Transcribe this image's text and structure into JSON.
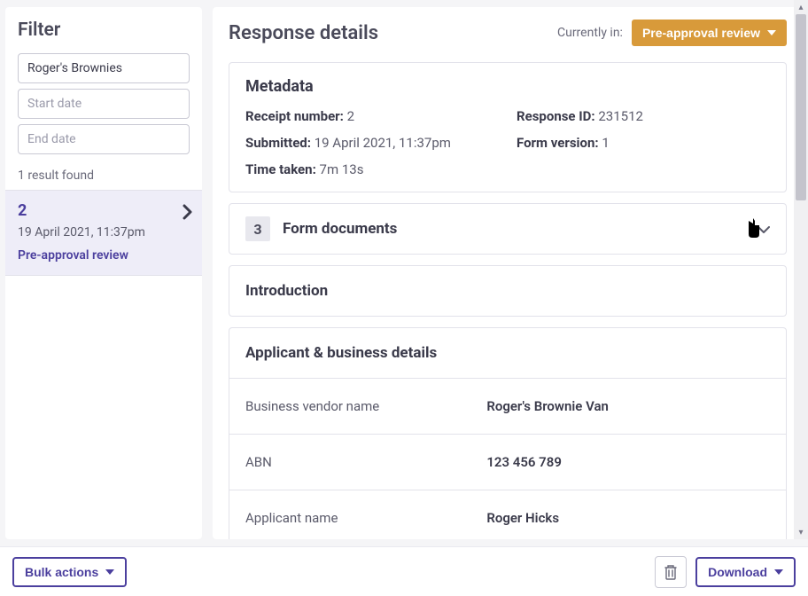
{
  "filter": {
    "title": "Filter",
    "search_value": "Roger's Brownies",
    "start_placeholder": "Start date",
    "end_placeholder": "End date",
    "results_count": "1 result found"
  },
  "result": {
    "id": "2",
    "date": "19 April 2021, 11:37pm",
    "status": "Pre-approval review"
  },
  "details": {
    "title": "Response details",
    "currently_label": "Currently in:",
    "status": "Pre-approval review"
  },
  "metadata": {
    "heading": "Metadata",
    "receipt_label": "Receipt number:",
    "receipt_value": "2",
    "response_id_label": "Response ID:",
    "response_id_value": "231512",
    "submitted_label": "Submitted:",
    "submitted_value": "19 April 2021, 11:37pm",
    "form_version_label": "Form version:",
    "form_version_value": "1",
    "time_taken_label": "Time taken:",
    "time_taken_value": "7m 13s"
  },
  "form_documents": {
    "count": "3",
    "label": "Form documents"
  },
  "sections": {
    "introduction": "Introduction",
    "applicant_heading": "Applicant & business details",
    "rows": [
      {
        "label": "Business vendor name",
        "value": "Roger's Brownie Van"
      },
      {
        "label": "ABN",
        "value": "123 456 789"
      },
      {
        "label": "Applicant name",
        "value": "Roger Hicks"
      }
    ]
  },
  "footer": {
    "bulk_actions": "Bulk actions",
    "download": "Download"
  }
}
